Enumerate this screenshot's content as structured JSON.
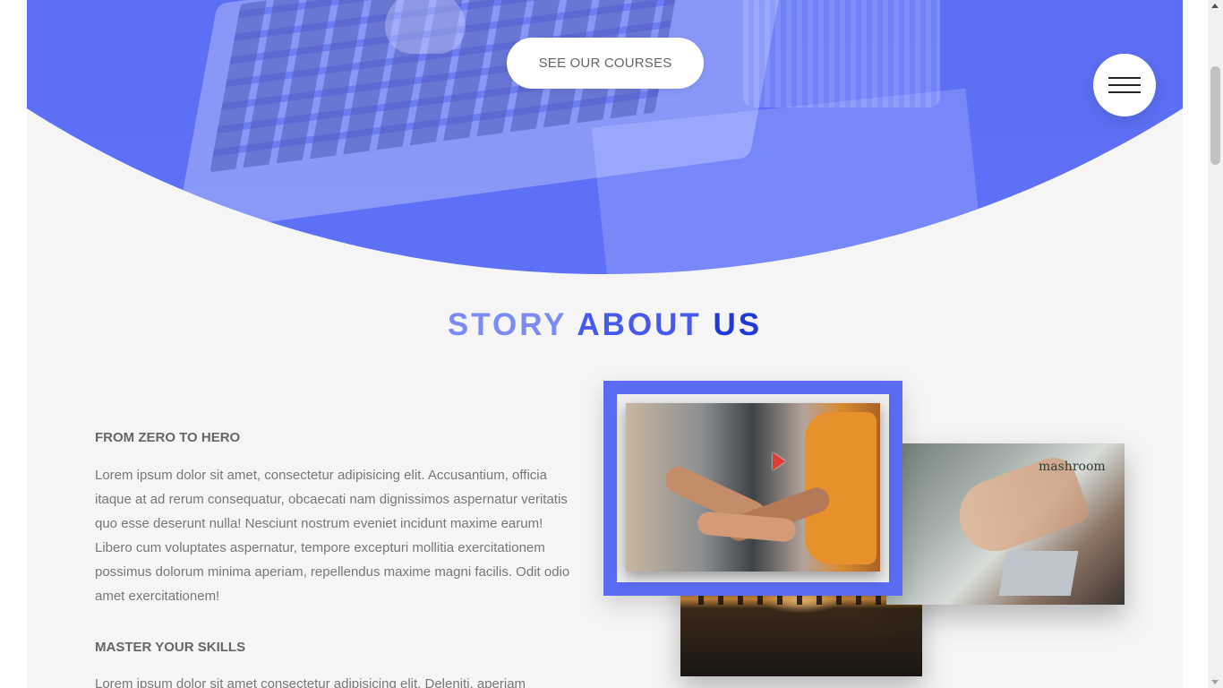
{
  "hero": {
    "cta_label": "SEE OUR COURSES",
    "menu_icon": "hamburger-icon",
    "accent_color": "#5a6cf3"
  },
  "story": {
    "title_word1": "STORY",
    "title_word2": "ABOUT",
    "title_word3": "US",
    "blocks": [
      {
        "heading": "FROM ZERO TO HERO",
        "text": "Lorem ipsum dolor sit amet, consectetur adipisicing elit. Accusantium, officia itaque at ad rerum consequatur, obcaecati nam dignissimos aspernatur veritatis quo esse deserunt nulla! Nesciunt nostrum eveniet incidunt maxime earum! Libero cum voluptates aspernatur, tempore excepturi mollitia exercitationem possimus dolorum minima aperiam, repellendus maxime magni facilis. Odit odio amet exercitationem!"
      },
      {
        "heading": "MASTER YOUR SKILLS",
        "text": "Lorem ipsum dolor sit amet consectetur adipisicing elit. Deleniti, aperiam"
      }
    ],
    "images": {
      "office_sign": "mashroom"
    }
  }
}
